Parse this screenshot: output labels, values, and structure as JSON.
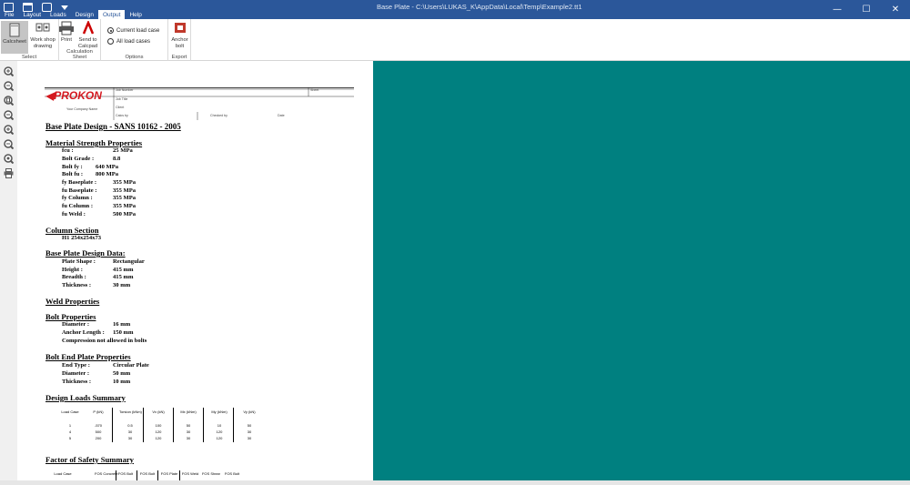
{
  "window": {
    "title": "Base Plate - C:\\Users\\LUKAS_K\\AppData\\Local\\Temp\\Example2.tt1",
    "controls": {
      "minimize": "—",
      "maximize": "☐",
      "close": "✕"
    }
  },
  "menu": {
    "tabs": [
      "File",
      "Layout",
      "Loads",
      "Design",
      "Output",
      "Help"
    ],
    "active": "Output"
  },
  "ribbon": {
    "select_group": {
      "label": "Select",
      "calc_sheet": "Calcsheet",
      "workshop": "Work shop drawing"
    },
    "calc_group": {
      "label": "Calculation Sheet",
      "print": "Print",
      "send": "Send to Calcpad"
    },
    "options_group": {
      "label": "Options",
      "current_load": "Current load case",
      "all_load": "All load cases",
      "selected": "current"
    },
    "export_group": {
      "label": "Export",
      "anchor": "Anchor bolt"
    }
  },
  "left_tools": [
    "zoom-in-icon",
    "zoom-out-icon",
    "zoom-page-icon",
    "zoom-width-icon",
    "zoom-plus-icon",
    "zoom-minus-icon",
    "zoom-fit-icon",
    "print-icon"
  ],
  "document": {
    "logo": "PROKON",
    "header": {
      "job_number": "Job Number",
      "sheet": "Sheet",
      "job_title": "Job Title",
      "client": "Client",
      "calcs_by": "Calcs by",
      "checked_by": "Checked by",
      "date": "Date",
      "software": "Your Company Name"
    },
    "main_title": "Base Plate Design - SANS 10162 - 2005",
    "material": {
      "title": "Material Strength Properties",
      "rows": [
        {
          "label": "fcu :",
          "value": "25 MPa"
        },
        {
          "label": "Bolt Grade :",
          "value": "8.8"
        },
        {
          "label": "Bolt fy :",
          "value": "640 MPa"
        },
        {
          "label": "Bolt fu :",
          "value": "800 MPa"
        },
        {
          "label": "fy Baseplate :",
          "value": "355 MPa"
        },
        {
          "label": "fu Baseplate :",
          "value": "355 MPa"
        },
        {
          "label": "fy Column :",
          "value": "355 MPa"
        },
        {
          "label": "fu Column :",
          "value": "355 MPa"
        },
        {
          "label": "fu Weld :",
          "value": "500 MPa"
        }
      ]
    },
    "column": {
      "title": "Column Section",
      "value": "H1 254x254x73"
    },
    "baseplate": {
      "title": "Base Plate Design Data:",
      "rows": [
        {
          "label": "Plate Shape :",
          "value": "Rectangular"
        },
        {
          "label": "Height :",
          "value": "415 mm"
        },
        {
          "label": "Breadth :",
          "value": "415 mm"
        },
        {
          "label": "Thickness :",
          "value": "30 mm"
        }
      ]
    },
    "weld": {
      "title": "Weld Properties"
    },
    "bolt": {
      "title": "Bolt Properties",
      "rows": [
        {
          "label": "Diameter :",
          "value": "16 mm"
        },
        {
          "label": "Anchor Length :",
          "value": "150 mm"
        }
      ],
      "note": "Compression not allowed in bolts"
    },
    "boltend": {
      "title": "Bolt End Plate Properties",
      "rows": [
        {
          "label": "End Type :",
          "value": "Circular Plate"
        },
        {
          "label": "Diameter :",
          "value": "50 mm"
        },
        {
          "label": "Thickness :",
          "value": "10 mm"
        }
      ]
    },
    "loads": {
      "title": "Design Loads Summary",
      "headers": [
        "Load Case",
        "P (kN)",
        "Torsion (kNm)",
        "Vx (kN)",
        "Mx (kNm)",
        "My (kNm)",
        "Vy (kN)"
      ],
      "rows": [
        [
          "1",
          "-570",
          "0.5",
          "100",
          "50",
          "10",
          "50"
        ],
        [
          "4",
          "500",
          "30",
          "120",
          "30",
          "120",
          "30"
        ],
        [
          "5",
          "200",
          "30",
          "120",
          "30",
          "120",
          "30"
        ]
      ]
    },
    "safety": {
      "title": "Factor of Safety Summary",
      "headers": [
        "Load Case",
        "FOS Concrete",
        "FOS Bolt",
        "FOS Bolt",
        "FOS Plate",
        "FOS Weld",
        "FOS Shear",
        "FOS Bolt"
      ]
    }
  },
  "colors": {
    "titlebar": "#2b579a",
    "viewer": "#008080"
  }
}
